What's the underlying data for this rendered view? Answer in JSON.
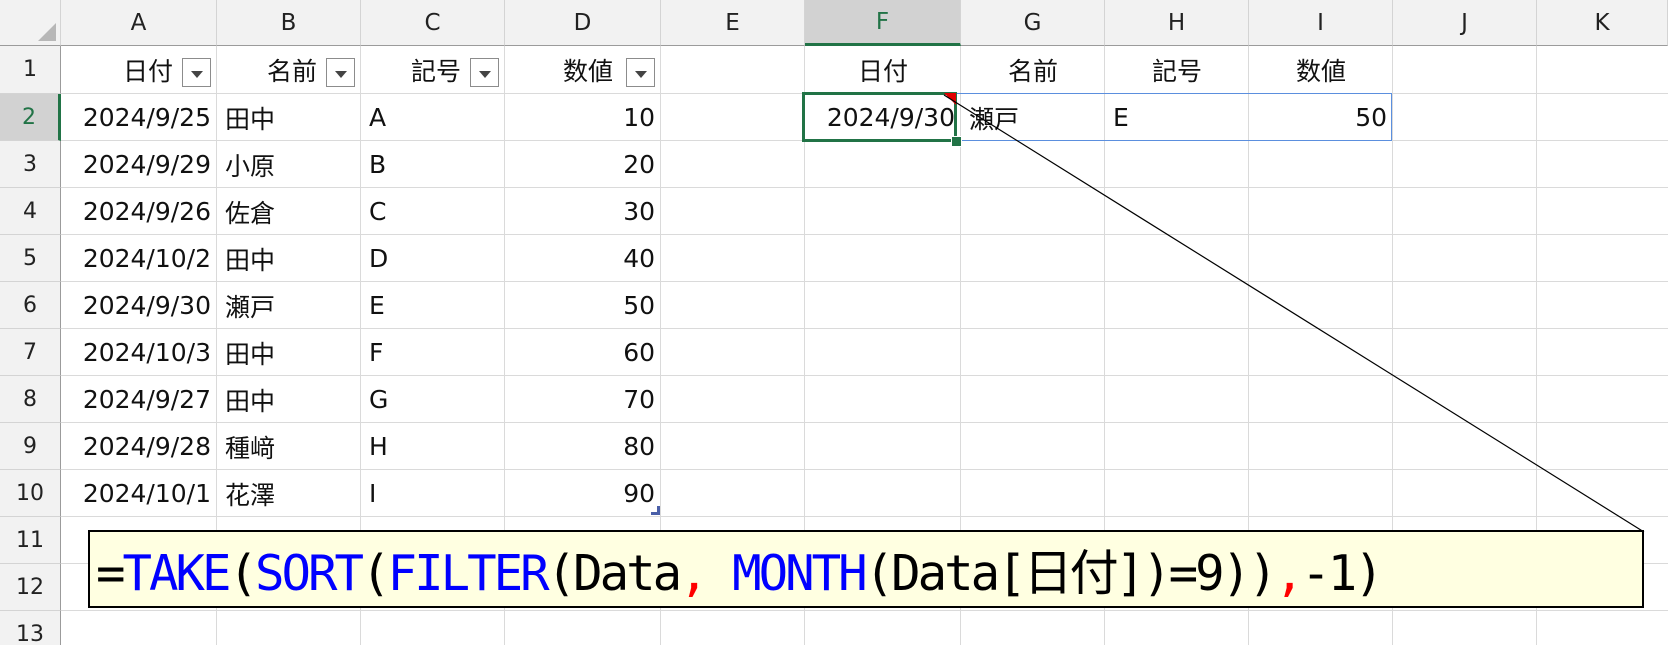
{
  "columns": [
    "A",
    "B",
    "C",
    "D",
    "E",
    "F",
    "G",
    "H",
    "I",
    "J",
    "K"
  ],
  "rows": [
    "1",
    "2",
    "3",
    "4",
    "5",
    "6",
    "7",
    "8",
    "9",
    "10",
    "11",
    "12",
    "13"
  ],
  "source_table": {
    "headers": [
      "日付",
      "名前",
      "記号",
      "数値"
    ],
    "rows": [
      [
        "2024/9/25",
        "田中",
        "A",
        "10"
      ],
      [
        "2024/9/29",
        "小原",
        "B",
        "20"
      ],
      [
        "2024/9/26",
        "佐倉",
        "C",
        "30"
      ],
      [
        "2024/10/2",
        "田中",
        "D",
        "40"
      ],
      [
        "2024/9/30",
        "瀬戸",
        "E",
        "50"
      ],
      [
        "2024/10/3",
        "田中",
        "F",
        "60"
      ],
      [
        "2024/9/27",
        "田中",
        "G",
        "70"
      ],
      [
        "2024/9/28",
        "種﨑",
        "H",
        "80"
      ],
      [
        "2024/10/1",
        "花澤",
        "I",
        "90"
      ]
    ]
  },
  "result_table": {
    "headers": [
      "日付",
      "名前",
      "記号",
      "数値"
    ],
    "row": [
      "2024/9/30",
      "瀬戸",
      "E",
      "50"
    ]
  },
  "selection": {
    "active_cell": "F2",
    "selected_column": "F",
    "selected_row": "2"
  },
  "formula": {
    "tokens": [
      {
        "text": "=",
        "color": "#000000"
      },
      {
        "text": "TAKE",
        "color": "#0000ff"
      },
      {
        "text": "(",
        "color": "#000000"
      },
      {
        "text": "SORT",
        "color": "#0000ff"
      },
      {
        "text": "(",
        "color": "#000000"
      },
      {
        "text": "FILTER",
        "color": "#0000ff"
      },
      {
        "text": "(Data",
        "color": "#000000"
      },
      {
        "text": ",",
        "color": "#ff0000"
      },
      {
        "text": " ",
        "color": "#000000"
      },
      {
        "text": "MONTH",
        "color": "#0000ff"
      },
      {
        "text": "(Data[日付])=9))",
        "color": "#000000"
      },
      {
        "text": ",",
        "color": "#ff0000"
      },
      {
        "text": "-1)",
        "color": "#000000"
      }
    ]
  },
  "colors": {
    "selection_green": "#217346",
    "spill_border": "#5b8fde",
    "callout_bg": "#ffffe1"
  }
}
